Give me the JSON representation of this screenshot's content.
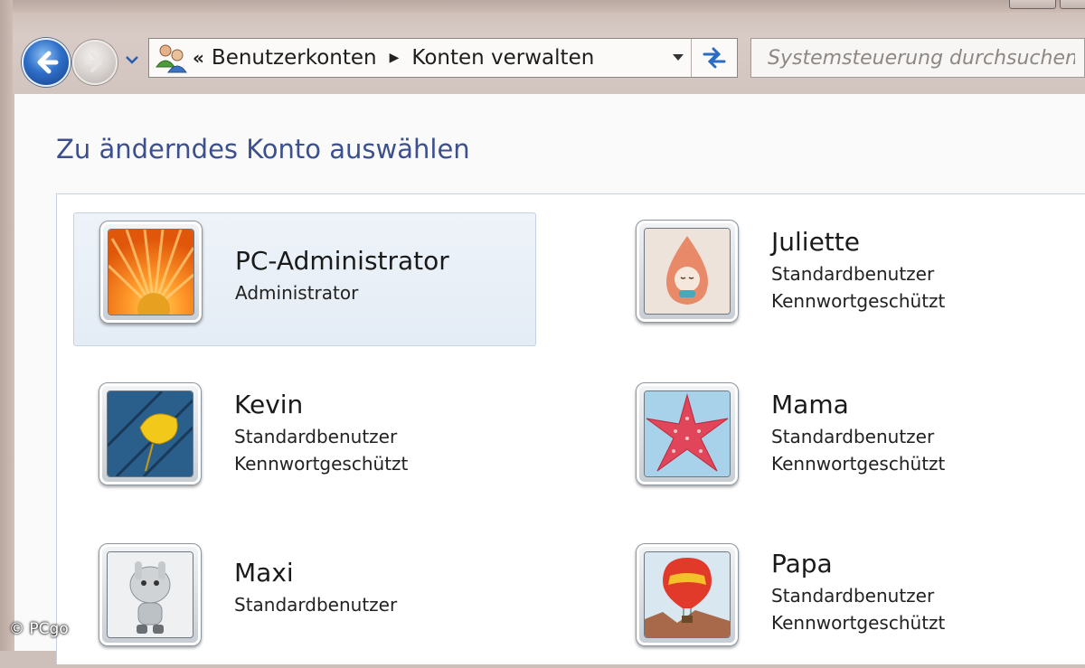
{
  "navigation": {
    "back_icon": "back-arrow-icon",
    "forward_icon": "forward-arrow-icon",
    "history_dropdown_icon": "chevron-down-icon",
    "address_icon": "user-accounts-icon",
    "breadcrumb_overflow": "«",
    "breadcrumbs": [
      "Benutzerkonten",
      "Konten verwalten"
    ],
    "breadcrumb_separator": "▶",
    "address_dropdown_icon": "chevron-down-icon",
    "refresh_icon": "refresh-icon"
  },
  "search": {
    "placeholder": "Systemsteuerung durchsuchen"
  },
  "main": {
    "title": "Zu änderndes Konto auswählen"
  },
  "accounts": [
    {
      "name": "PC-Administrator",
      "lines": [
        "Administrator"
      ],
      "picture": "flower-picture",
      "selected": true
    },
    {
      "name": "Juliette",
      "lines": [
        "Standardbenutzer",
        "Kennwortgeschützt"
      ],
      "picture": "doll-picture",
      "selected": false
    },
    {
      "name": "Kevin",
      "lines": [
        "Standardbenutzer",
        "Kennwortgeschützt"
      ],
      "picture": "leaf-picture",
      "selected": false
    },
    {
      "name": "Mama",
      "lines": [
        "Standardbenutzer",
        "Kennwortgeschützt"
      ],
      "picture": "starfish-picture",
      "selected": false
    },
    {
      "name": "Maxi",
      "lines": [
        "Standardbenutzer"
      ],
      "picture": "robot-picture",
      "selected": false
    },
    {
      "name": "Papa",
      "lines": [
        "Standardbenutzer",
        "Kennwortgeschützt"
      ],
      "picture": "balloon-picture",
      "selected": false
    }
  ],
  "watermark": "© PCgo",
  "colors": {
    "title": "#3c4f8f",
    "selection": "#e6edf6"
  }
}
